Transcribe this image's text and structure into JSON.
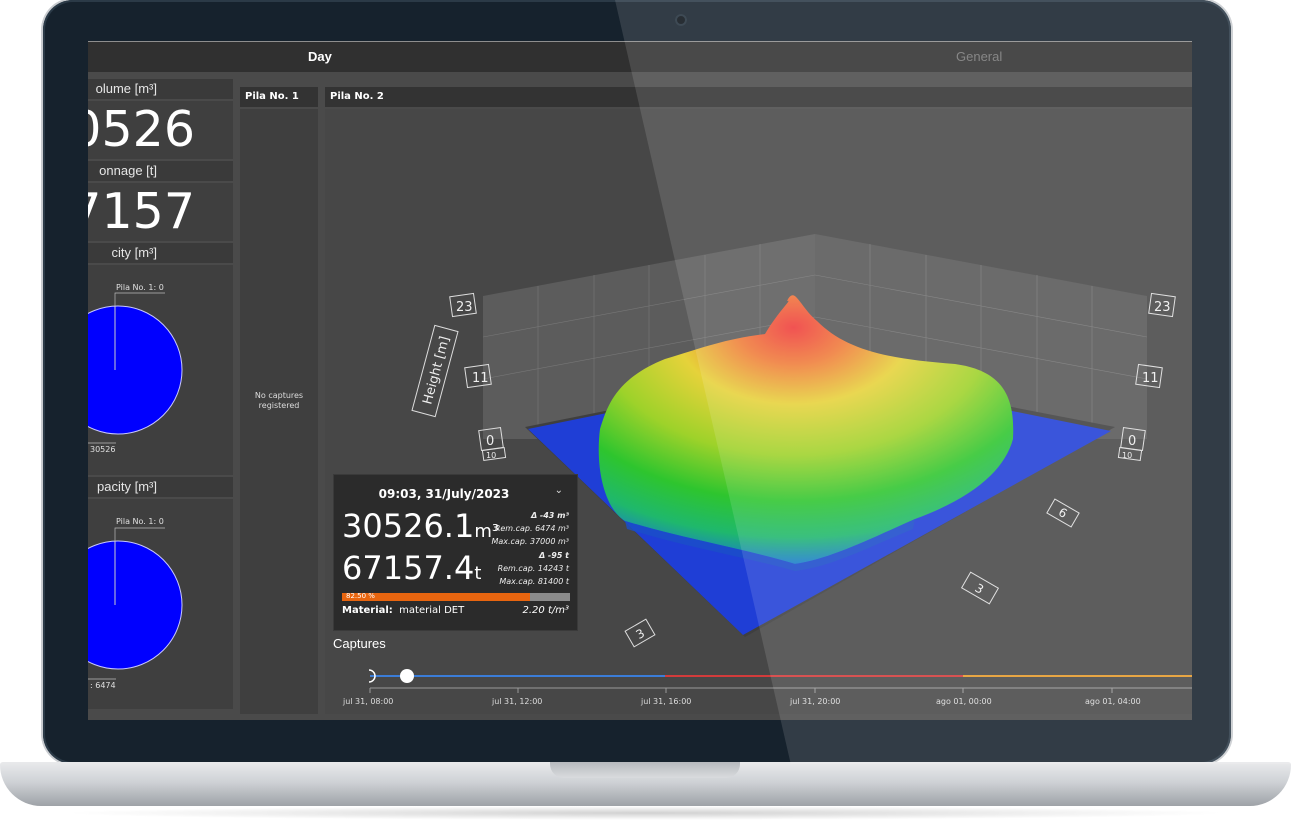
{
  "tabs": [
    {
      "label": "Day",
      "active": true
    },
    {
      "label": "General",
      "active": false
    }
  ],
  "left_panel": {
    "volume_label": "olume [m³]",
    "volume_value": "0526",
    "tonnage_label": "onnage [t]",
    "tonnage_value": "7157",
    "capacity_label": "city [m³]",
    "capacity_pie_top_label": "Pila No. 1: 0",
    "capacity_pie_bottom_label": "30526",
    "capacity2_label": "pacity [m³]",
    "capacity2_pie_top_label": "Pila No. 1: 0",
    "capacity2_pie_bottom_label": ": 6474",
    "pie_color": "#0000ff"
  },
  "pila1": {
    "title": "Pila No. 1",
    "empty_text": "No captures\nregistered"
  },
  "pila2": {
    "title": "Pila No. 2",
    "height_axis_label": "Height [m]",
    "z_ticks": [
      "23",
      "11",
      "0"
    ],
    "left_ticks_bottom": [
      "10"
    ],
    "right_ticks_bottom": [
      "10"
    ],
    "front_ticks": [
      "3",
      "6"
    ],
    "side_ticks": [
      "3"
    ]
  },
  "info_card": {
    "datetime": "09:03, 31/July/2023",
    "volume": "30526.1",
    "volume_unit": "m³",
    "volume_delta": "Δ -43 m³",
    "volume_rem_cap": "Rem.cap. 6474 m³",
    "volume_max_cap": "Max.cap. 37000 m³",
    "tonnage": "67157.4",
    "tonnage_unit": "t",
    "tonnage_delta": "Δ -95 t",
    "tonnage_rem_cap": "Rem.cap. 14243 t",
    "tonnage_max_cap": "Max.cap. 81400 t",
    "progress_label": "82.50 %",
    "progress_fraction": 0.825,
    "material_label": "Material:",
    "material_value": "material DET",
    "density": "2.20 t/m³"
  },
  "captures": {
    "title": "Captures",
    "ticks": [
      "jul 31, 08:00",
      "jul 31, 12:00",
      "jul 31, 16:00",
      "jul 31, 20:00",
      "ago 01, 00:00",
      "ago 01, 04:00"
    ],
    "segment_colors": [
      "#3b7dd8",
      "#d33b3b",
      "#e59a2b"
    ]
  }
}
